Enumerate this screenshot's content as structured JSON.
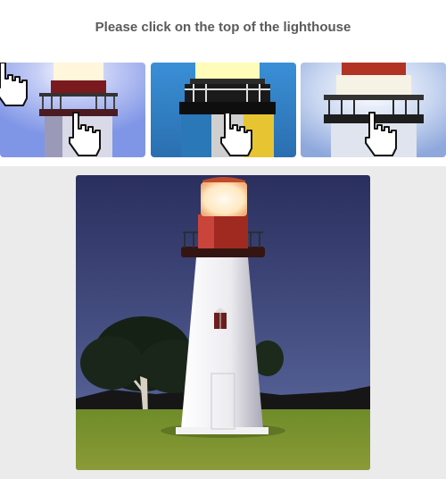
{
  "prompt": {
    "text": "Please click on the top of the lighthouse"
  },
  "examples": [
    {
      "name": "example-1",
      "sky": "#7f95e6"
    },
    {
      "name": "example-2",
      "sky": "#2f7bc4"
    },
    {
      "name": "example-3",
      "sky": "#9db6e4"
    }
  ],
  "task": {
    "sky_top": "#2a2f5e",
    "sky_bottom": "#5c6aa0",
    "grass": "#6e8a2a",
    "lantern_glow": "#fff3d6",
    "band_red": "#b02a22"
  },
  "colors": {
    "title": "#5a5a5a",
    "panel_bg": "#ebebeb"
  }
}
